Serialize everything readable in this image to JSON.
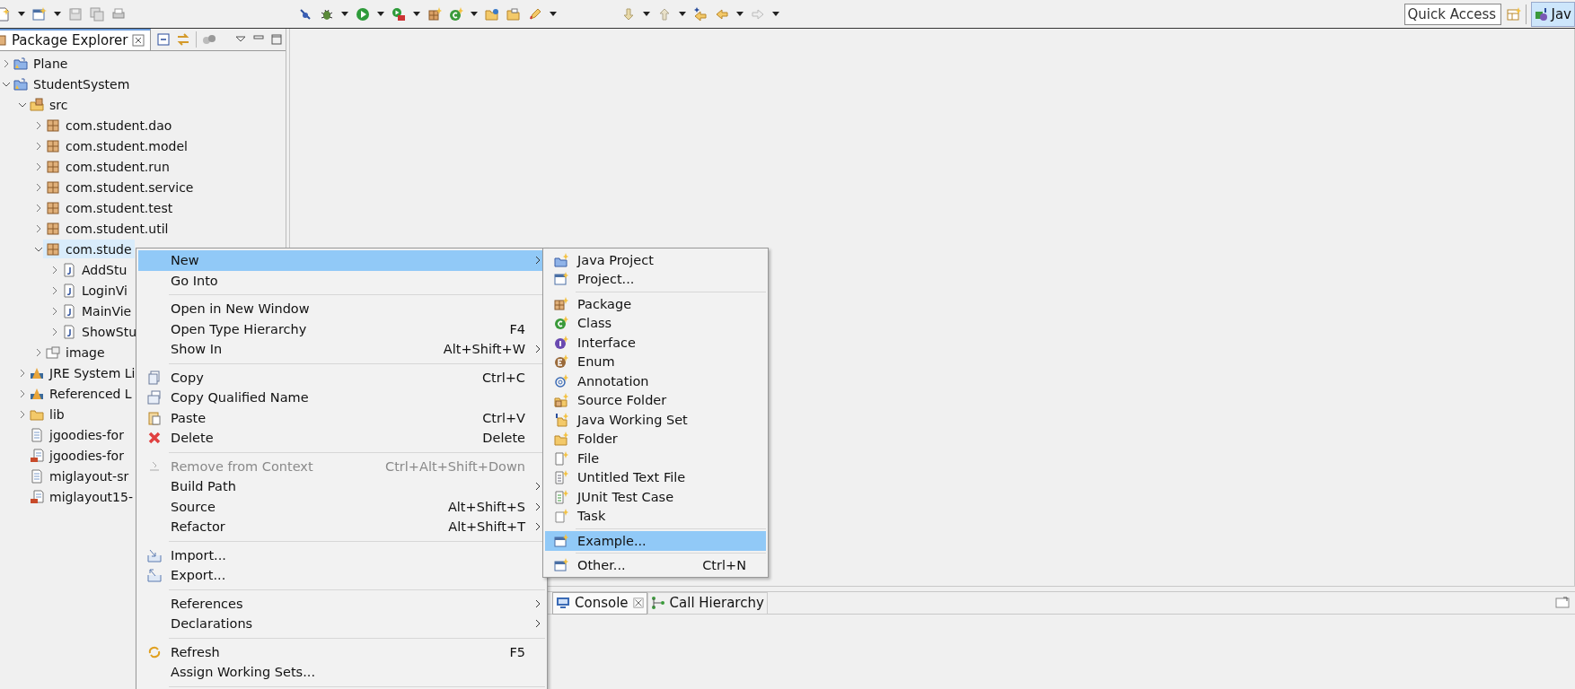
{
  "toolbar": {
    "quick_access": {
      "placeholder": "Quick Access"
    },
    "perspective": {
      "label": "Jav",
      "selected": true
    }
  },
  "package_explorer": {
    "tab": {
      "label": "Package Explorer",
      "selected": true
    },
    "tree": [
      {
        "label": "Plane",
        "kind": "project",
        "expanded": false,
        "selected": false
      },
      {
        "label": "StudentSystem",
        "kind": "project",
        "expanded": true,
        "selected": false,
        "children": [
          {
            "label": "src",
            "kind": "source-folder",
            "expanded": true,
            "selected": false,
            "children": [
              {
                "label": "com.student.dao",
                "kind": "package",
                "expanded": false,
                "selected": false
              },
              {
                "label": "com.student.model",
                "kind": "package",
                "expanded": false,
                "selected": false
              },
              {
                "label": "com.student.run",
                "kind": "package",
                "expanded": false,
                "selected": false
              },
              {
                "label": "com.student.service",
                "kind": "package",
                "expanded": false,
                "selected": false
              },
              {
                "label": "com.student.test",
                "kind": "package",
                "expanded": false,
                "selected": false
              },
              {
                "label": "com.student.util",
                "kind": "package",
                "expanded": false,
                "selected": false
              },
              {
                "label": "com.stude",
                "kind": "package",
                "expanded": true,
                "selected": true,
                "children": [
                  {
                    "label": "AddStu",
                    "kind": "java-file",
                    "expanded": false,
                    "selected": false
                  },
                  {
                    "label": "LoginVi",
                    "kind": "java-file",
                    "expanded": false,
                    "selected": false
                  },
                  {
                    "label": "MainVie",
                    "kind": "java-file",
                    "expanded": false,
                    "selected": false
                  },
                  {
                    "label": "ShowStu",
                    "kind": "java-file",
                    "expanded": false,
                    "selected": false
                  }
                ]
              },
              {
                "label": "image",
                "kind": "package-folder",
                "expanded": false,
                "selected": false
              }
            ]
          },
          {
            "label": "JRE System Li",
            "kind": "library",
            "expanded": false,
            "selected": false
          },
          {
            "label": "Referenced L",
            "kind": "library",
            "expanded": false,
            "selected": false
          },
          {
            "label": "lib",
            "kind": "folder",
            "expanded": false,
            "selected": false
          },
          {
            "label": "jgoodies-for",
            "kind": "file",
            "selected": false
          },
          {
            "label": "jgoodies-for",
            "kind": "jar",
            "selected": false
          },
          {
            "label": "miglayout-sr",
            "kind": "file",
            "selected": false
          },
          {
            "label": "miglayout15-",
            "kind": "jar",
            "selected": false
          }
        ]
      }
    ]
  },
  "context_menu": {
    "items": [
      {
        "kind": "item",
        "label": "New",
        "submenu": true,
        "selected": true,
        "disabled": false
      },
      {
        "kind": "item",
        "label": "Go Into",
        "selected": false,
        "disabled": false
      },
      {
        "kind": "separator"
      },
      {
        "kind": "item",
        "label": "Open in New Window",
        "selected": false,
        "disabled": false
      },
      {
        "kind": "item",
        "label": "Open Type Hierarchy",
        "shortcut": "F4",
        "selected": false,
        "disabled": false
      },
      {
        "kind": "item",
        "label": "Show In",
        "shortcut": "Alt+Shift+W",
        "submenu": true,
        "selected": false,
        "disabled": false
      },
      {
        "kind": "separator"
      },
      {
        "kind": "item",
        "label": "Copy",
        "shortcut": "Ctrl+C",
        "selected": false,
        "disabled": false
      },
      {
        "kind": "item",
        "label": "Copy Qualified Name",
        "selected": false,
        "disabled": false
      },
      {
        "kind": "item",
        "label": "Paste",
        "shortcut": "Ctrl+V",
        "selected": false,
        "disabled": false
      },
      {
        "kind": "item",
        "label": "Delete",
        "shortcut": "Delete",
        "selected": false,
        "disabled": false
      },
      {
        "kind": "separator"
      },
      {
        "kind": "item",
        "label": "Remove from Context",
        "shortcut": "Ctrl+Alt+Shift+Down",
        "selected": false,
        "disabled": true
      },
      {
        "kind": "item",
        "label": "Build Path",
        "submenu": true,
        "selected": false,
        "disabled": false
      },
      {
        "kind": "item",
        "label": "Source",
        "shortcut": "Alt+Shift+S",
        "submenu": true,
        "selected": false,
        "disabled": false
      },
      {
        "kind": "item",
        "label": "Refactor",
        "shortcut": "Alt+Shift+T",
        "submenu": true,
        "selected": false,
        "disabled": false
      },
      {
        "kind": "separator"
      },
      {
        "kind": "item",
        "label": "Import...",
        "selected": false,
        "disabled": false
      },
      {
        "kind": "item",
        "label": "Export...",
        "selected": false,
        "disabled": false
      },
      {
        "kind": "separator"
      },
      {
        "kind": "item",
        "label": "References",
        "submenu": true,
        "selected": false,
        "disabled": false
      },
      {
        "kind": "item",
        "label": "Declarations",
        "submenu": true,
        "selected": false,
        "disabled": false
      },
      {
        "kind": "separator"
      },
      {
        "kind": "item",
        "label": "Refresh",
        "shortcut": "F5",
        "selected": false,
        "disabled": false
      },
      {
        "kind": "item",
        "label": "Assign Working Sets...",
        "selected": false,
        "disabled": false
      },
      {
        "kind": "separator"
      }
    ]
  },
  "submenu": {
    "items": [
      {
        "kind": "item",
        "label": "Java Project",
        "selected": false
      },
      {
        "kind": "item",
        "label": "Project...",
        "selected": false
      },
      {
        "kind": "separator"
      },
      {
        "kind": "item",
        "label": "Package",
        "selected": false
      },
      {
        "kind": "item",
        "label": "Class",
        "selected": false
      },
      {
        "kind": "item",
        "label": "Interface",
        "selected": false
      },
      {
        "kind": "item",
        "label": "Enum",
        "selected": false
      },
      {
        "kind": "item",
        "label": "Annotation",
        "selected": false
      },
      {
        "kind": "item",
        "label": "Source Folder",
        "selected": false
      },
      {
        "kind": "item",
        "label": "Java Working Set",
        "selected": false
      },
      {
        "kind": "item",
        "label": "Folder",
        "selected": false
      },
      {
        "kind": "item",
        "label": "File",
        "selected": false
      },
      {
        "kind": "item",
        "label": "Untitled Text File",
        "selected": false
      },
      {
        "kind": "item",
        "label": "JUnit Test Case",
        "selected": false
      },
      {
        "kind": "item",
        "label": "Task",
        "selected": false
      },
      {
        "kind": "separator"
      },
      {
        "kind": "item",
        "label": "Example...",
        "selected": true
      },
      {
        "kind": "separator"
      },
      {
        "kind": "item",
        "label": "Other...",
        "shortcut": "Ctrl+N",
        "selected": false
      }
    ]
  },
  "bottom_panel": {
    "tabs": [
      {
        "label": "Console",
        "selected": true
      },
      {
        "label": "Call Hierarchy",
        "selected": false
      }
    ]
  }
}
